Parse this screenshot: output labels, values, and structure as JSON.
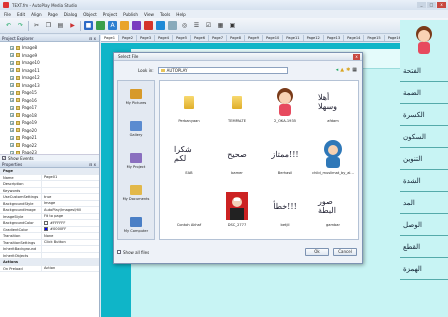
{
  "app": {
    "title": "TEXT.fm - AutoPlay Media Studio"
  },
  "window_controls": {
    "min": "_",
    "max": "□",
    "close": "x"
  },
  "menu": [
    "File",
    "Edit",
    "Align",
    "Page",
    "Dialog",
    "Object",
    "Project",
    "Publish",
    "View",
    "Tools",
    "Help"
  ],
  "project_explorer": {
    "title": "Project Explorer",
    "items": [
      "Image8",
      "Image9",
      "Image10",
      "Image11",
      "Image12",
      "Image13",
      "Page15",
      "Page16",
      "Page17",
      "Page18",
      "Page19",
      "Page20",
      "Page21",
      "Page22",
      "Page23"
    ],
    "show_events": "Show Events"
  },
  "properties": {
    "title": "Properties",
    "group1": "Page",
    "rows": [
      {
        "k": "Name",
        "v": "Page01"
      },
      {
        "k": "Description",
        "v": ""
      },
      {
        "k": "Keywords",
        "v": ""
      },
      {
        "k": "UseCustomSettings",
        "v": "true"
      },
      {
        "k": "BackgroundStyle",
        "v": "Image"
      },
      {
        "k": "BackgroundImage",
        "v": "AutoPlay\\Images\\Hill"
      },
      {
        "k": "ImageStyle",
        "v": "Fit to page"
      },
      {
        "k": "BackgroundColor",
        "v": "#FFFFFF"
      },
      {
        "k": "GradientColor",
        "v": "#0000FF"
      },
      {
        "k": "Transition",
        "v": "None"
      },
      {
        "k": "TransitionSettings",
        "v": "Click Button"
      },
      {
        "k": "InheritBackground",
        "v": ""
      },
      {
        "k": "InheritObjects",
        "v": ""
      }
    ],
    "group2": "Actions",
    "rows2": [
      {
        "k": "On Preload",
        "v": "Action"
      }
    ]
  },
  "page_tabs": [
    "Page1",
    "Page2",
    "Page3",
    "Page4",
    "Page5",
    "Page6",
    "Page7",
    "Page8",
    "Page9",
    "Page10",
    "Page11",
    "Page12",
    "Page13",
    "Page14",
    "Page15",
    "Page16",
    "Page17",
    "Page18",
    "Page19"
  ],
  "right_arabic": [
    "الفتحة",
    "الضمة",
    "الكسرة",
    "السكون",
    "التنوين",
    "الشدة",
    "المد",
    "الوصل",
    "القطع",
    "الهمزة"
  ],
  "dialog": {
    "title": "Select File",
    "look_in_label": "Look in:",
    "look_in_value": "AUTOPLAY",
    "places": [
      "My Pictures",
      "Gallery",
      "My Project",
      "My Documents",
      "My Computer"
    ],
    "files": [
      {
        "name": "Perbanyaan",
        "kind": "folder"
      },
      {
        "name": "TEMPALTE",
        "kind": "folder"
      },
      {
        "name": "2_OKA-1935",
        "kind": "girl"
      },
      {
        "name": "afdam",
        "kind": "arabic",
        "glyph": "أهلا وسهلا"
      },
      {
        "name": "EAB",
        "kind": "arabic",
        "glyph": "شكرا لكم"
      },
      {
        "name": "bamer",
        "kind": "arabic",
        "glyph": "صحيح"
      },
      {
        "name": "Berhasil",
        "kind": "arabic",
        "glyph": "ممتاز!!!"
      },
      {
        "name": "child_muslimat_by_al...",
        "kind": "hijab"
      },
      {
        "name": "Contoh Akhaf",
        "kind": "blank"
      },
      {
        "name": "DSC_2777",
        "kind": "photo"
      },
      {
        "name": "betjil",
        "kind": "arabic",
        "glyph": "خطأ!!!"
      },
      {
        "name": "gambar",
        "kind": "arabic",
        "glyph": "صور البطة"
      }
    ],
    "show_all": "Show all files",
    "ok": "Ok",
    "cancel": "Cancel"
  },
  "colors": {
    "canvas": "#0fb5c8",
    "page": "#c8f4f4",
    "accent": "#c8483f"
  }
}
